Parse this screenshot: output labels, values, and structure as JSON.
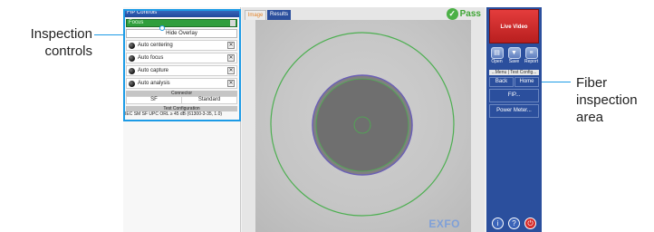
{
  "callouts": {
    "left_line1": "Inspection",
    "left_line2": "controls",
    "right_line1": "Fiber",
    "right_line2": "inspection",
    "right_line3": "area"
  },
  "controls": {
    "title": "FIP Controls",
    "focus_label": "Focus",
    "hide_overlay": "Hide Overlay",
    "options": [
      {
        "label": "Auto centering",
        "close": "✕"
      },
      {
        "label": "Auto focus",
        "close": "✕"
      },
      {
        "label": "Auto capture",
        "close": "✕"
      },
      {
        "label": "Auto analysis",
        "close": "✕"
      }
    ],
    "connector_header": "Connector",
    "connector_type": "SF",
    "connector_standard": "Standard",
    "test_config_header": "Test Configuration",
    "test_config_value": "IEC SM SF UPC ORL ≥ 45 dB (61300-3-35, 1.0)"
  },
  "viewer": {
    "tabs": [
      "Image",
      "Results"
    ],
    "active_tab": "Image",
    "status": "Pass",
    "watermark": "EXFO"
  },
  "sidebar": {
    "live_video": "Live Video",
    "actions": [
      "Open",
      "Save",
      "Report"
    ],
    "menu_caption": "...Menu | Test Config...",
    "back": "Back",
    "home": "Home",
    "menu_items": [
      "FIP...",
      "Power Meter..."
    ],
    "round_buttons": [
      "i",
      "?",
      "⏻"
    ]
  },
  "colors": {
    "accent": "#1d9be6",
    "menu_blue": "#2b4f9d",
    "pass_green": "#3fa535",
    "live_red": "#d42d2d",
    "ring_green": "#4caf50",
    "ring_purple": "#6b5fb5"
  }
}
